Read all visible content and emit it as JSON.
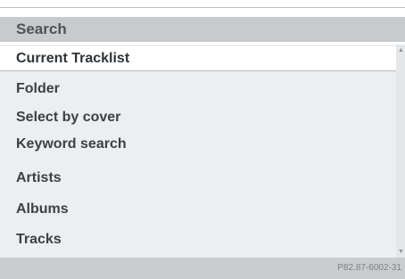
{
  "header": {
    "title": "Search"
  },
  "menu": {
    "items": [
      {
        "label": "Current Tracklist",
        "selected": true
      },
      {
        "label": "Folder",
        "selected": false
      },
      {
        "label": "Select by cover",
        "selected": false
      },
      {
        "label": "Keyword search",
        "selected": false
      },
      {
        "label": "Artists",
        "selected": false
      },
      {
        "label": "Albums",
        "selected": false
      },
      {
        "label": "Tracks",
        "selected": false
      }
    ]
  },
  "scrollbar": {
    "up_icon": "scroll-up-arrow",
    "down_icon": "scroll-down-arrow"
  },
  "footer": {
    "figure_code": "P82.87-6002-31"
  }
}
